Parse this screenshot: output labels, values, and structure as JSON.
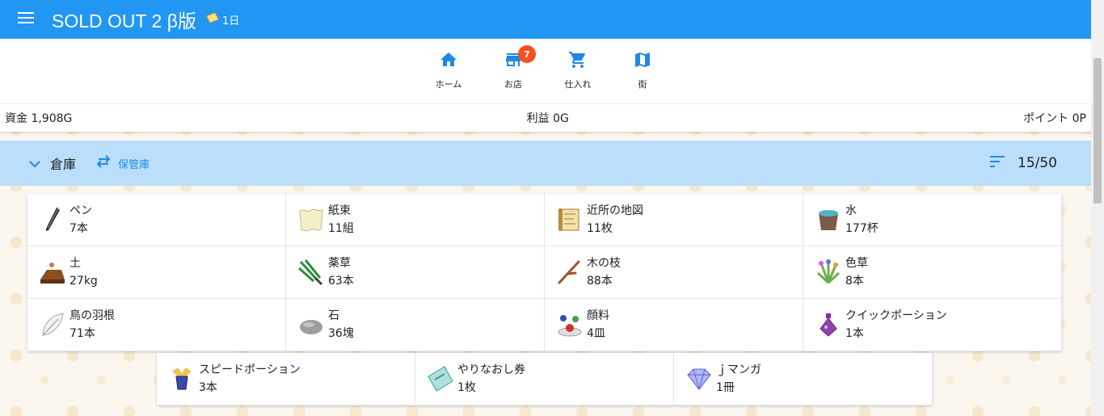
{
  "app": {
    "title": "SOLD OUT 2 β版",
    "day": "1日"
  },
  "nav": [
    {
      "label": "ホーム",
      "icon": "home-icon"
    },
    {
      "label": "お店",
      "icon": "store-icon",
      "badge": "7"
    },
    {
      "label": "仕入れ",
      "icon": "cart-icon"
    },
    {
      "label": "街",
      "icon": "map-icon"
    }
  ],
  "stats": {
    "funds": "資金 1,908G",
    "profit": "利益 0G",
    "points": "ポイント 0P"
  },
  "warehouse": {
    "title": "倉庫",
    "storage_label": "保管庫",
    "count": "15/50"
  },
  "items": [
    {
      "name": "ペン",
      "qty": "7本",
      "icon": "pen-icon"
    },
    {
      "name": "紙束",
      "qty": "11組",
      "icon": "paper-bundle-icon"
    },
    {
      "name": "近所の地図",
      "qty": "11枚",
      "icon": "map-scroll-icon"
    },
    {
      "name": "水",
      "qty": "177杯",
      "icon": "water-bucket-icon"
    },
    {
      "name": "土",
      "qty": "27kg",
      "icon": "soil-icon"
    },
    {
      "name": "薬草",
      "qty": "63本",
      "icon": "herb-icon"
    },
    {
      "name": "木の枝",
      "qty": "88本",
      "icon": "branch-icon"
    },
    {
      "name": "色草",
      "qty": "8本",
      "icon": "color-grass-icon"
    },
    {
      "name": "鳥の羽根",
      "qty": "71本",
      "icon": "feather-icon"
    },
    {
      "name": "石",
      "qty": "36塊",
      "icon": "stone-icon"
    },
    {
      "name": "顔料",
      "qty": "4皿",
      "icon": "pigment-icon"
    },
    {
      "name": "クイックポーション",
      "qty": "1本",
      "icon": "quick-potion-icon"
    },
    {
      "name": "スピードポーション",
      "qty": "3本",
      "icon": "speed-potion-icon"
    },
    {
      "name": "やりなおし券",
      "qty": "1枚",
      "icon": "retry-ticket-icon"
    },
    {
      "name": "ｊマンガ",
      "qty": "1冊",
      "icon": "gem-icon"
    }
  ],
  "colors": {
    "appbar": "#2196f3",
    "warehouse_bar": "#bbdefb",
    "badge": "#f4511e",
    "accent": "#1e88e5"
  }
}
